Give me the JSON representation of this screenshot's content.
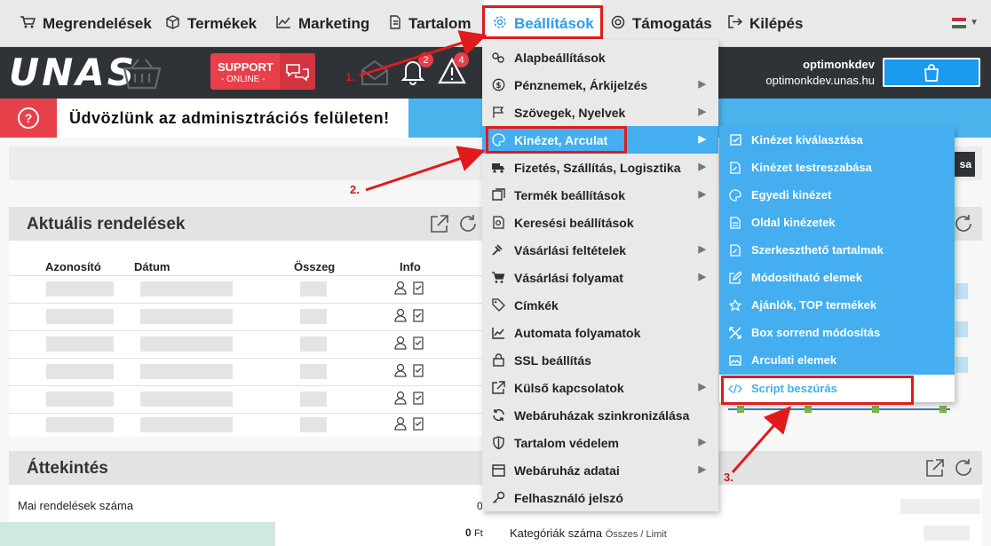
{
  "nav": {
    "items": [
      {
        "label": "Megrendelések",
        "icon": "cart-icon"
      },
      {
        "label": "Termékek",
        "icon": "box-icon"
      },
      {
        "label": "Marketing",
        "icon": "chart-icon"
      },
      {
        "label": "Tartalom",
        "icon": "document-icon"
      },
      {
        "label": "Beállítások",
        "icon": "gear-icon"
      },
      {
        "label": "Támogatás",
        "icon": "lifebuoy-icon"
      },
      {
        "label": "Kilépés",
        "icon": "logout-icon"
      }
    ],
    "active": "Beállítások",
    "language_flag_colors": [
      "#cd2a3e",
      "#ffffff",
      "#436f4d"
    ]
  },
  "header": {
    "logo_text": "UNAS",
    "support_line1": "SUPPORT",
    "support_line2": "- ONLINE -",
    "notification_count": "2",
    "alert_count": "4",
    "username": "optimonkdev",
    "domain": "optimonkdev.unas.hu"
  },
  "welcome": {
    "text": "Üdvözlünk az adminisztrációs felületen!",
    "help_icon": "?"
  },
  "dark_button_text": "sa",
  "orders": {
    "title": "Aktuális rendelések",
    "columns": [
      "Azonosító",
      "Dátum",
      "Összeg",
      "Info"
    ],
    "row_count": 6
  },
  "overview": {
    "title": "Áttekintés",
    "stat1_label": "Mai rendelések száma",
    "stat1_value": "0",
    "stat2_value": "0",
    "stat2_unit": "Ft",
    "stat3_label": "Kategóriák száma",
    "stat3_sub": "Összes / Limit"
  },
  "settings_menu": [
    {
      "label": "Alapbeállítások",
      "icon": "gears-icon",
      "submenu": false
    },
    {
      "label": "Pénznemek, Árkijelzés",
      "icon": "currency-icon",
      "submenu": true
    },
    {
      "label": "Szövegek, Nyelvek",
      "icon": "flag-icon",
      "submenu": true
    },
    {
      "label": "Kinézet, Arculat",
      "icon": "palette-icon",
      "submenu": true
    },
    {
      "label": "Fizetés, Szállítás, Logisztika",
      "icon": "truck-icon",
      "submenu": true
    },
    {
      "label": "Termék beállítások",
      "icon": "product-settings-icon",
      "submenu": true
    },
    {
      "label": "Keresési beállítások",
      "icon": "search-settings-icon",
      "submenu": false
    },
    {
      "label": "Vásárlási feltételek",
      "icon": "gavel-icon",
      "submenu": true
    },
    {
      "label": "Vásárlási folyamat",
      "icon": "cart-process-icon",
      "submenu": true
    },
    {
      "label": "Címkék",
      "icon": "tag-icon",
      "submenu": false
    },
    {
      "label": "Automata folyamatok",
      "icon": "automation-icon",
      "submenu": false
    },
    {
      "label": "SSL beállítás",
      "icon": "lock-icon",
      "submenu": false
    },
    {
      "label": "Külső kapcsolatok",
      "icon": "external-link-icon",
      "submenu": true
    },
    {
      "label": "Webáruházak szinkronizálása",
      "icon": "sync-icon",
      "submenu": false
    },
    {
      "label": "Tartalom védelem",
      "icon": "shield-icon",
      "submenu": true
    },
    {
      "label": "Webáruház adatai",
      "icon": "store-icon",
      "submenu": true
    },
    {
      "label": "Felhasználó jelszó",
      "icon": "key-icon",
      "submenu": false
    }
  ],
  "highlighted_menu_item": "Kinézet, Arculat",
  "appearance_submenu": [
    {
      "label": "Kinézet kiválasztása",
      "icon": "checkbox-icon"
    },
    {
      "label": "Kinézet testreszabása",
      "icon": "file-edit-icon"
    },
    {
      "label": "Egyedi kinézet",
      "icon": "palette-icon"
    },
    {
      "label": "Oldal kinézetek",
      "icon": "pages-icon"
    },
    {
      "label": "Szerkeszthető tartalmak",
      "icon": "file-edit-icon"
    },
    {
      "label": "Módosítható elemek",
      "icon": "edit-icon"
    },
    {
      "label": "Ajánlók, TOP termékek",
      "icon": "star-icon"
    },
    {
      "label": "Box sorrend módosítás",
      "icon": "arrange-icon"
    },
    {
      "label": "Arculati elemek",
      "icon": "image-icon"
    },
    {
      "label": "Script beszúrás",
      "icon": "code-icon"
    }
  ],
  "annotations": {
    "step1": "1.",
    "step2": "2.",
    "step3": "3.",
    "color": "#e01b1b"
  }
}
